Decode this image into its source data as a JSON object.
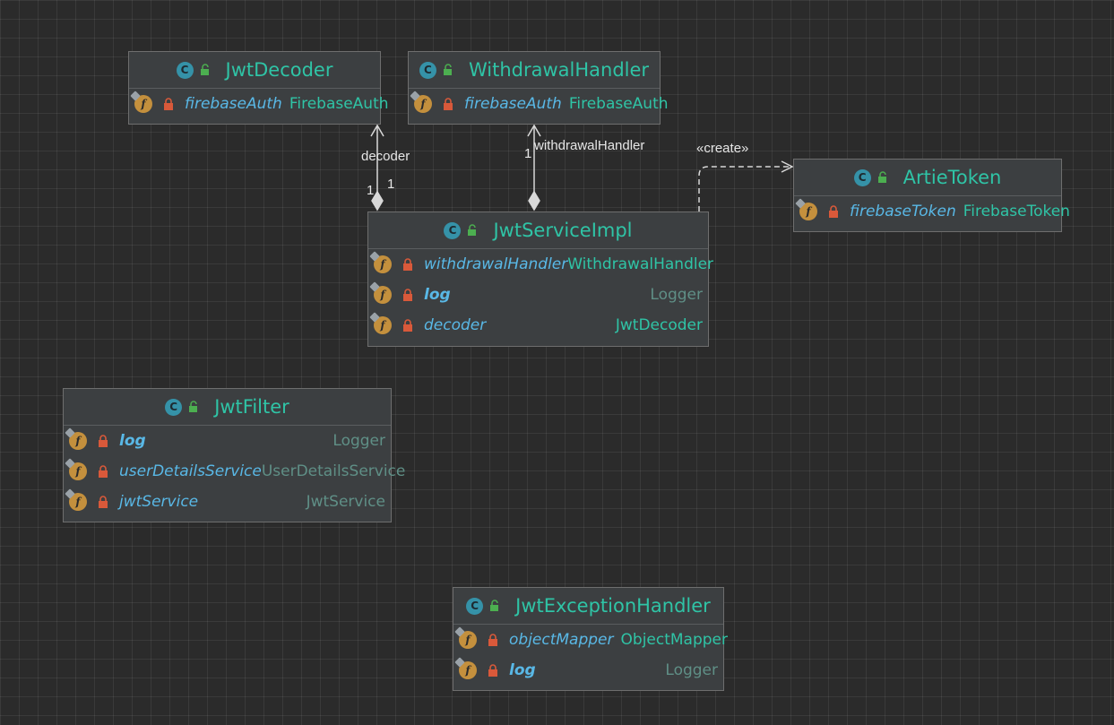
{
  "classes": {
    "jwt_decoder": {
      "name": "JwtDecoder",
      "fields": [
        {
          "name": "firebaseAuth",
          "type": "FirebaseAuth"
        }
      ]
    },
    "withdrawal_handler": {
      "name": "WithdrawalHandler",
      "fields": [
        {
          "name": "firebaseAuth",
          "type": "FirebaseAuth"
        }
      ]
    },
    "artie_token": {
      "name": "ArtieToken",
      "fields": [
        {
          "name": "firebaseToken",
          "type": "FirebaseToken"
        }
      ]
    },
    "jwt_service_impl": {
      "name": "JwtServiceImpl",
      "fields": [
        {
          "name": "withdrawalHandler",
          "type": "WithdrawalHandler"
        },
        {
          "name": "log",
          "type": "Logger"
        },
        {
          "name": "decoder",
          "type": "JwtDecoder"
        }
      ]
    },
    "jwt_filter": {
      "name": "JwtFilter",
      "fields": [
        {
          "name": "log",
          "type": "Logger"
        },
        {
          "name": "userDetailsService",
          "type": "UserDetailsService"
        },
        {
          "name": "jwtService",
          "type": "JwtService"
        }
      ]
    },
    "jwt_exception_handler": {
      "name": "JwtExceptionHandler",
      "fields": [
        {
          "name": "objectMapper",
          "type": "ObjectMapper"
        },
        {
          "name": "log",
          "type": "Logger"
        }
      ]
    }
  },
  "edges": {
    "decoder": {
      "label": "decoder",
      "target_mult": "1",
      "source_mult": "1"
    },
    "withdrawal": {
      "label": "withdrawalHandler",
      "mult": "1"
    },
    "create": {
      "label": "«create»"
    }
  },
  "icons": {
    "class_icon_letter": "C",
    "field_icon_letter": "f"
  },
  "colors": {
    "background": "#2b2b2b",
    "class_name": "#2fc4a6",
    "field_name": "#59b8e6",
    "field_icon": "#c4903d",
    "class_icon": "#3592a8",
    "lock": "#d9593a",
    "edge": "#d8d8d8"
  }
}
